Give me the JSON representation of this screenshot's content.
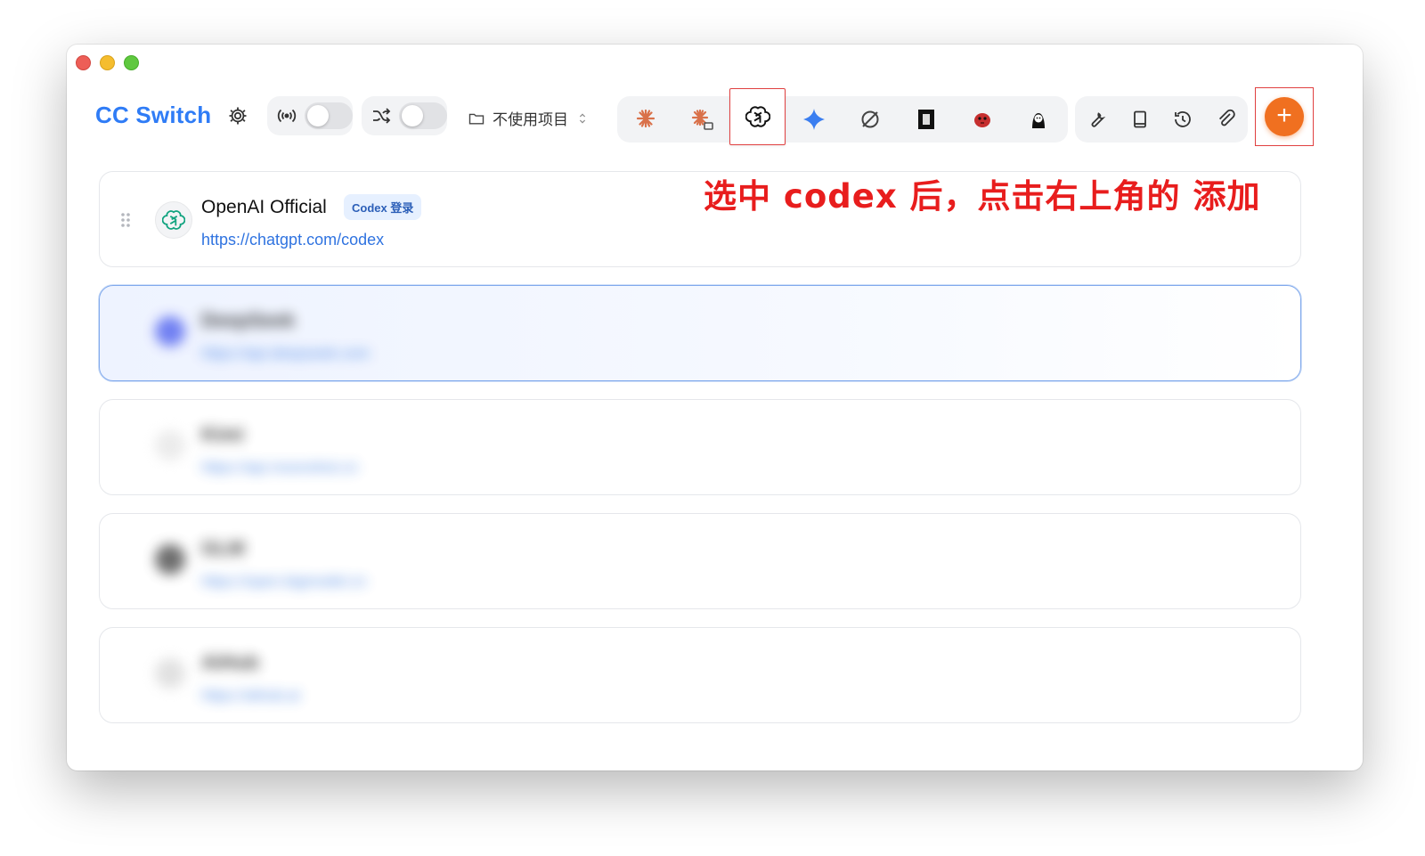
{
  "app": {
    "title": "CC Switch"
  },
  "toolbar": {
    "project_label": "不使用项目",
    "apps": [
      "claude-code-icon",
      "claude-desktop-icon",
      "openai-icon",
      "gemini-icon",
      "sync-icon",
      "black-square-icon",
      "red-bird-icon",
      "character-icon"
    ],
    "tools": [
      "wrench-icon",
      "book-icon",
      "history-icon",
      "paperclip-icon"
    ],
    "add_label": "+"
  },
  "providers": [
    {
      "name": "OpenAI Official",
      "badge": "Codex 登录",
      "url": "https://chatgpt.com/codex"
    },
    {
      "name": "DeepSeek",
      "url": "https://api.deepseek.com",
      "selected": true
    },
    {
      "name": "Kimi",
      "url": "https://api.moonshot.cn"
    },
    {
      "name": "GLM",
      "url": "https://open.bigmodel.cn"
    },
    {
      "name": "AiHub",
      "url": "https://aihub.ai"
    }
  ],
  "annotation": {
    "text": "选中 codex 后，点击右上角的 添加"
  },
  "colors": {
    "accent": "#2f7cf6",
    "add_button": "#f07020",
    "annotation": "#e81d1d",
    "highlight_box": "#e04040"
  }
}
